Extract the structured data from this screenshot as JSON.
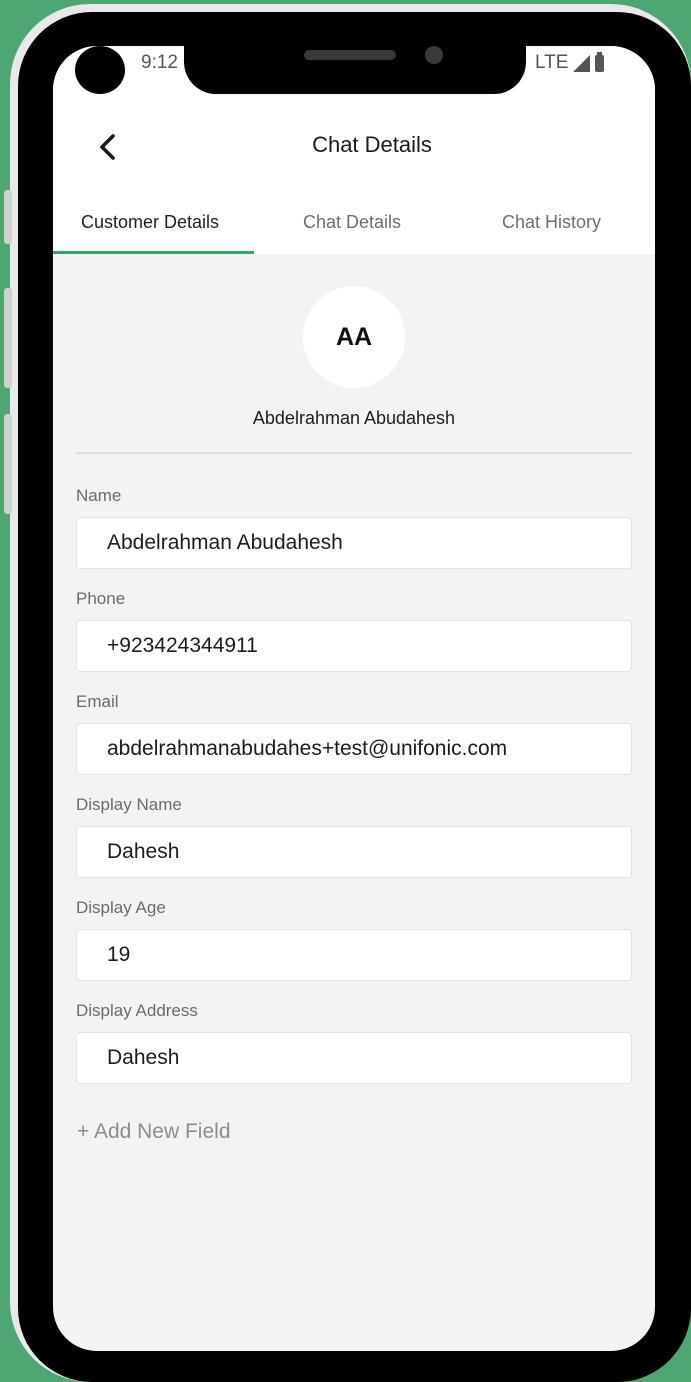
{
  "status_bar": {
    "time": "9:12",
    "network": "LTE"
  },
  "header": {
    "title": "Chat Details"
  },
  "tabs": [
    {
      "label": "Customer Details",
      "active": true
    },
    {
      "label": "Chat Details",
      "active": false
    },
    {
      "label": "Chat History",
      "active": false
    }
  ],
  "customer": {
    "initials": "AA",
    "full_name": "Abdelrahman Abudahesh"
  },
  "fields": [
    {
      "label": "Name",
      "value": "Abdelrahman Abudahesh"
    },
    {
      "label": "Phone",
      "value": "+923424344911"
    },
    {
      "label": "Email",
      "value": "abdelrahmanabudahes+test@unifonic.com"
    },
    {
      "label": "Display Name",
      "value": "Dahesh"
    },
    {
      "label": "Display Age",
      "value": "19"
    },
    {
      "label": "Display Address",
      "value": "Dahesh"
    }
  ],
  "add_field_label": "+ Add New Field",
  "colors": {
    "background": "#4ea773",
    "accent": "#2ea86b",
    "screen": "#f3f3f3"
  }
}
